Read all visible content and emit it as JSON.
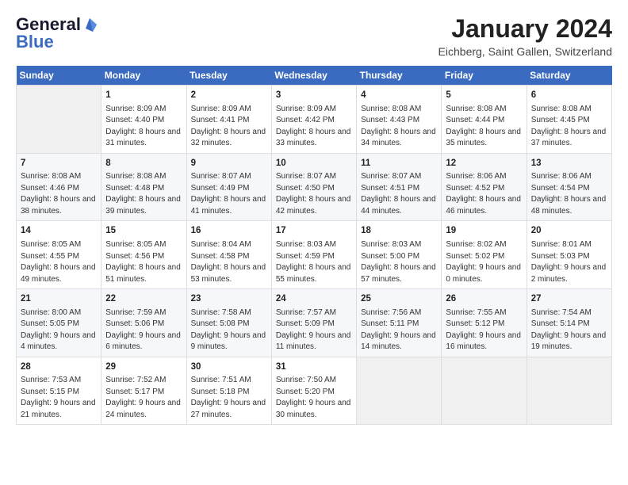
{
  "header": {
    "logo_general": "General",
    "logo_blue": "Blue",
    "month_title": "January 2024",
    "location": "Eichberg, Saint Gallen, Switzerland"
  },
  "days_of_week": [
    "Sunday",
    "Monday",
    "Tuesday",
    "Wednesday",
    "Thursday",
    "Friday",
    "Saturday"
  ],
  "weeks": [
    [
      {
        "day": "",
        "sunrise": "",
        "sunset": "",
        "daylight": ""
      },
      {
        "day": "1",
        "sunrise": "Sunrise: 8:09 AM",
        "sunset": "Sunset: 4:40 PM",
        "daylight": "Daylight: 8 hours and 31 minutes."
      },
      {
        "day": "2",
        "sunrise": "Sunrise: 8:09 AM",
        "sunset": "Sunset: 4:41 PM",
        "daylight": "Daylight: 8 hours and 32 minutes."
      },
      {
        "day": "3",
        "sunrise": "Sunrise: 8:09 AM",
        "sunset": "Sunset: 4:42 PM",
        "daylight": "Daylight: 8 hours and 33 minutes."
      },
      {
        "day": "4",
        "sunrise": "Sunrise: 8:08 AM",
        "sunset": "Sunset: 4:43 PM",
        "daylight": "Daylight: 8 hours and 34 minutes."
      },
      {
        "day": "5",
        "sunrise": "Sunrise: 8:08 AM",
        "sunset": "Sunset: 4:44 PM",
        "daylight": "Daylight: 8 hours and 35 minutes."
      },
      {
        "day": "6",
        "sunrise": "Sunrise: 8:08 AM",
        "sunset": "Sunset: 4:45 PM",
        "daylight": "Daylight: 8 hours and 37 minutes."
      }
    ],
    [
      {
        "day": "7",
        "sunrise": "Sunrise: 8:08 AM",
        "sunset": "Sunset: 4:46 PM",
        "daylight": "Daylight: 8 hours and 38 minutes."
      },
      {
        "day": "8",
        "sunrise": "Sunrise: 8:08 AM",
        "sunset": "Sunset: 4:48 PM",
        "daylight": "Daylight: 8 hours and 39 minutes."
      },
      {
        "day": "9",
        "sunrise": "Sunrise: 8:07 AM",
        "sunset": "Sunset: 4:49 PM",
        "daylight": "Daylight: 8 hours and 41 minutes."
      },
      {
        "day": "10",
        "sunrise": "Sunrise: 8:07 AM",
        "sunset": "Sunset: 4:50 PM",
        "daylight": "Daylight: 8 hours and 42 minutes."
      },
      {
        "day": "11",
        "sunrise": "Sunrise: 8:07 AM",
        "sunset": "Sunset: 4:51 PM",
        "daylight": "Daylight: 8 hours and 44 minutes."
      },
      {
        "day": "12",
        "sunrise": "Sunrise: 8:06 AM",
        "sunset": "Sunset: 4:52 PM",
        "daylight": "Daylight: 8 hours and 46 minutes."
      },
      {
        "day": "13",
        "sunrise": "Sunrise: 8:06 AM",
        "sunset": "Sunset: 4:54 PM",
        "daylight": "Daylight: 8 hours and 48 minutes."
      }
    ],
    [
      {
        "day": "14",
        "sunrise": "Sunrise: 8:05 AM",
        "sunset": "Sunset: 4:55 PM",
        "daylight": "Daylight: 8 hours and 49 minutes."
      },
      {
        "day": "15",
        "sunrise": "Sunrise: 8:05 AM",
        "sunset": "Sunset: 4:56 PM",
        "daylight": "Daylight: 8 hours and 51 minutes."
      },
      {
        "day": "16",
        "sunrise": "Sunrise: 8:04 AM",
        "sunset": "Sunset: 4:58 PM",
        "daylight": "Daylight: 8 hours and 53 minutes."
      },
      {
        "day": "17",
        "sunrise": "Sunrise: 8:03 AM",
        "sunset": "Sunset: 4:59 PM",
        "daylight": "Daylight: 8 hours and 55 minutes."
      },
      {
        "day": "18",
        "sunrise": "Sunrise: 8:03 AM",
        "sunset": "Sunset: 5:00 PM",
        "daylight": "Daylight: 8 hours and 57 minutes."
      },
      {
        "day": "19",
        "sunrise": "Sunrise: 8:02 AM",
        "sunset": "Sunset: 5:02 PM",
        "daylight": "Daylight: 9 hours and 0 minutes."
      },
      {
        "day": "20",
        "sunrise": "Sunrise: 8:01 AM",
        "sunset": "Sunset: 5:03 PM",
        "daylight": "Daylight: 9 hours and 2 minutes."
      }
    ],
    [
      {
        "day": "21",
        "sunrise": "Sunrise: 8:00 AM",
        "sunset": "Sunset: 5:05 PM",
        "daylight": "Daylight: 9 hours and 4 minutes."
      },
      {
        "day": "22",
        "sunrise": "Sunrise: 7:59 AM",
        "sunset": "Sunset: 5:06 PM",
        "daylight": "Daylight: 9 hours and 6 minutes."
      },
      {
        "day": "23",
        "sunrise": "Sunrise: 7:58 AM",
        "sunset": "Sunset: 5:08 PM",
        "daylight": "Daylight: 9 hours and 9 minutes."
      },
      {
        "day": "24",
        "sunrise": "Sunrise: 7:57 AM",
        "sunset": "Sunset: 5:09 PM",
        "daylight": "Daylight: 9 hours and 11 minutes."
      },
      {
        "day": "25",
        "sunrise": "Sunrise: 7:56 AM",
        "sunset": "Sunset: 5:11 PM",
        "daylight": "Daylight: 9 hours and 14 minutes."
      },
      {
        "day": "26",
        "sunrise": "Sunrise: 7:55 AM",
        "sunset": "Sunset: 5:12 PM",
        "daylight": "Daylight: 9 hours and 16 minutes."
      },
      {
        "day": "27",
        "sunrise": "Sunrise: 7:54 AM",
        "sunset": "Sunset: 5:14 PM",
        "daylight": "Daylight: 9 hours and 19 minutes."
      }
    ],
    [
      {
        "day": "28",
        "sunrise": "Sunrise: 7:53 AM",
        "sunset": "Sunset: 5:15 PM",
        "daylight": "Daylight: 9 hours and 21 minutes."
      },
      {
        "day": "29",
        "sunrise": "Sunrise: 7:52 AM",
        "sunset": "Sunset: 5:17 PM",
        "daylight": "Daylight: 9 hours and 24 minutes."
      },
      {
        "day": "30",
        "sunrise": "Sunrise: 7:51 AM",
        "sunset": "Sunset: 5:18 PM",
        "daylight": "Daylight: 9 hours and 27 minutes."
      },
      {
        "day": "31",
        "sunrise": "Sunrise: 7:50 AM",
        "sunset": "Sunset: 5:20 PM",
        "daylight": "Daylight: 9 hours and 30 minutes."
      },
      {
        "day": "",
        "sunrise": "",
        "sunset": "",
        "daylight": ""
      },
      {
        "day": "",
        "sunrise": "",
        "sunset": "",
        "daylight": ""
      },
      {
        "day": "",
        "sunrise": "",
        "sunset": "",
        "daylight": ""
      }
    ]
  ]
}
